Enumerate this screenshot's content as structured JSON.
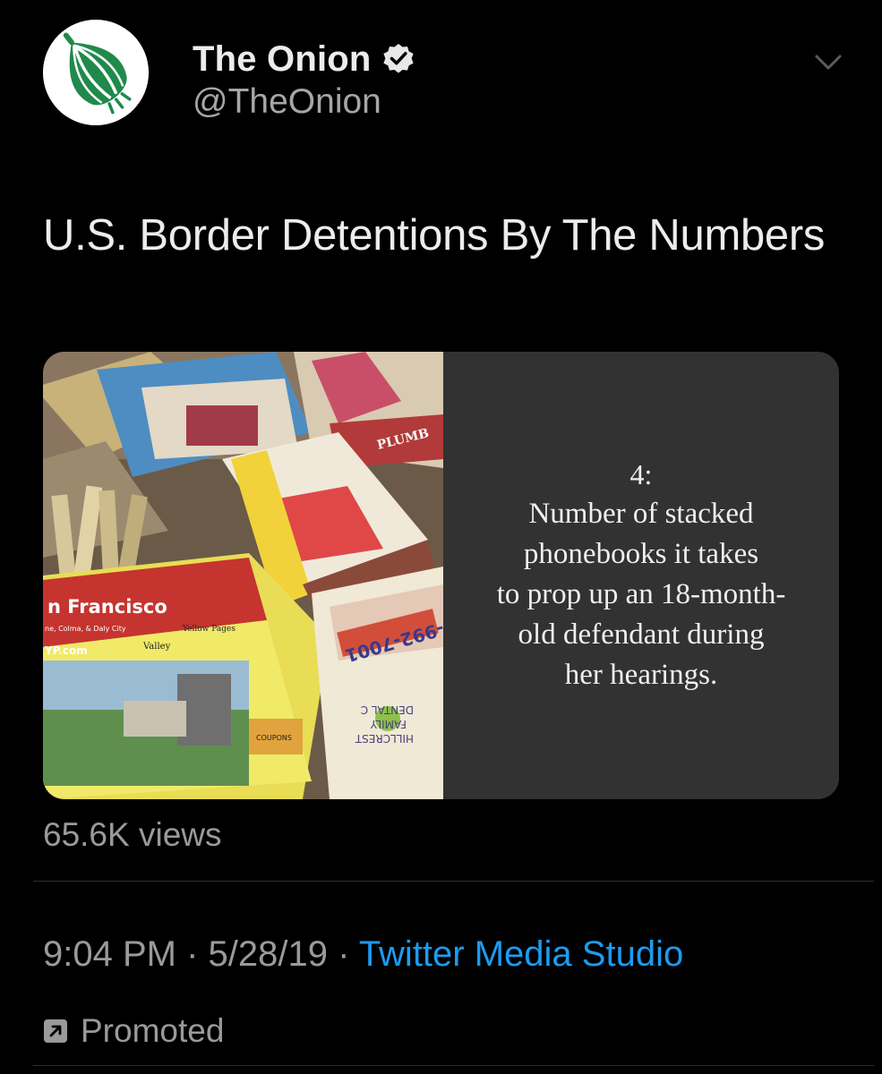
{
  "author": {
    "display_name": "The Onion",
    "handle": "@TheOnion",
    "avatar_icon": "onion-logo-icon",
    "verified_icon": "verified-badge-icon",
    "brand_color": "#1f8a4c"
  },
  "tweet": {
    "text": "U.S. Border Detentions By The Numbers"
  },
  "media": {
    "photo_labels": [
      "n Francisco",
      "ne, Colma, & Daly City",
      "YP.com",
      "Valley",
      "Yellow Pages",
      "COUPONS",
      "HILLCREST",
      "FAMILY",
      "DENTAL C",
      "-992-7001",
      "PLUMB"
    ],
    "card_number": "4:",
    "card_lines": [
      "Number of stacked",
      "phonebooks it takes",
      "to prop up an 18-month-",
      "old defendant during",
      "her hearings."
    ]
  },
  "stats": {
    "views": "65.6K views"
  },
  "meta": {
    "time": "9:04 PM",
    "separator": " · ",
    "date": "5/28/19",
    "source": "Twitter Media Studio",
    "promoted": "Promoted",
    "promoted_icon": "promoted-arrow-icon",
    "link_color": "#1d9bf0"
  },
  "menu": {
    "chevron_icon": "chevron-down-icon"
  }
}
